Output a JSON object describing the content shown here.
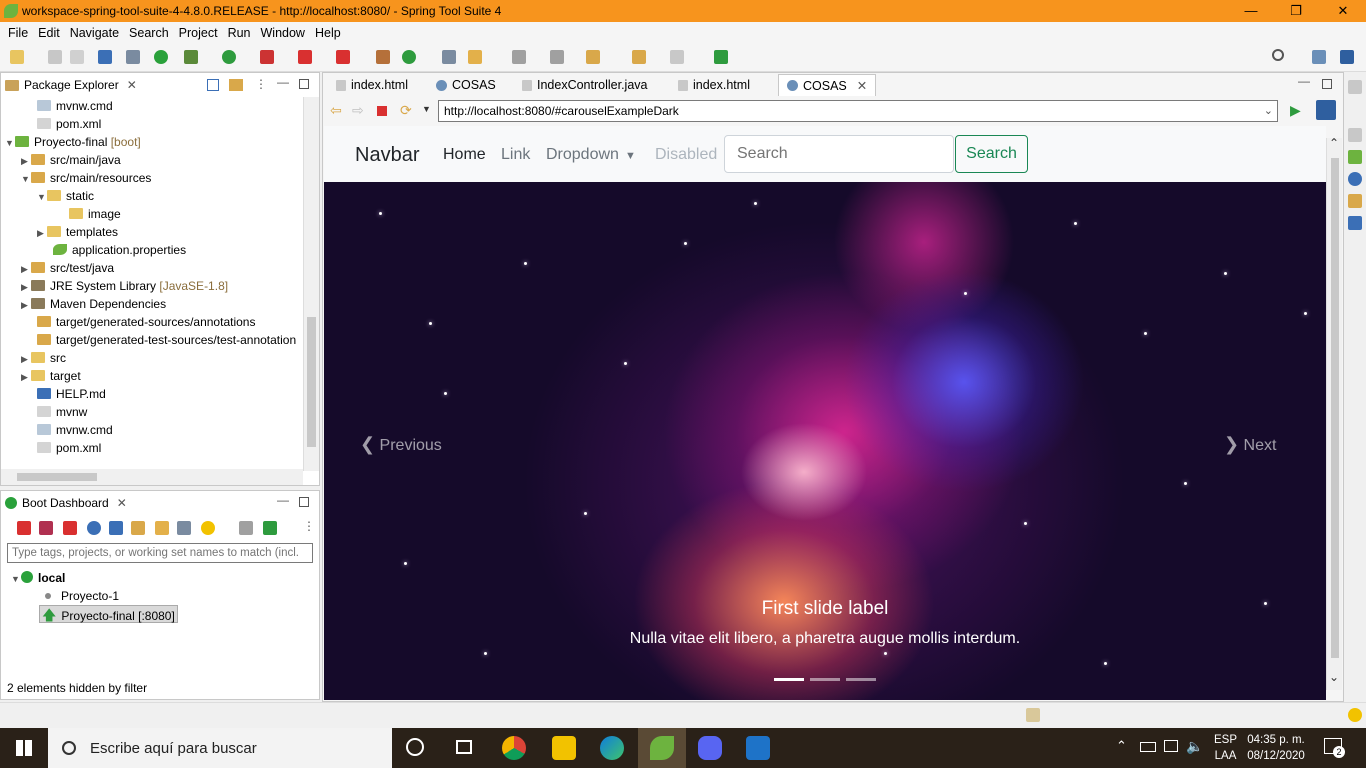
{
  "window": {
    "title": "workspace-spring-tool-suite-4-4.8.0.RELEASE - http://localhost:8080/ - Spring Tool Suite 4"
  },
  "menu": [
    "File",
    "Edit",
    "Navigate",
    "Search",
    "Project",
    "Run",
    "Window",
    "Help"
  ],
  "package_explorer": {
    "title": "Package Explorer",
    "items": [
      {
        "label": "mvnw.cmd",
        "decor": ""
      },
      {
        "label": "pom.xml",
        "decor": ""
      },
      {
        "label": "Proyecto-final",
        "decor": "[boot]"
      },
      {
        "label": "src/main/java",
        "decor": ""
      },
      {
        "label": "src/main/resources",
        "decor": ""
      },
      {
        "label": "static",
        "decor": ""
      },
      {
        "label": "image",
        "decor": ""
      },
      {
        "label": "templates",
        "decor": ""
      },
      {
        "label": "application.properties",
        "decor": ""
      },
      {
        "label": "src/test/java",
        "decor": ""
      },
      {
        "label": "JRE System Library",
        "decor": "[JavaSE-1.8]"
      },
      {
        "label": "Maven Dependencies",
        "decor": ""
      },
      {
        "label": "target/generated-sources/annotations",
        "decor": ""
      },
      {
        "label": "target/generated-test-sources/test-annotation",
        "decor": ""
      },
      {
        "label": "src",
        "decor": ""
      },
      {
        "label": "target",
        "decor": ""
      },
      {
        "label": "HELP.md",
        "decor": ""
      },
      {
        "label": "mvnw",
        "decor": ""
      },
      {
        "label": "mvnw.cmd",
        "decor": ""
      },
      {
        "label": "pom.xml",
        "decor": ""
      }
    ]
  },
  "boot_dashboard": {
    "title": "Boot Dashboard",
    "filter_placeholder": "Type tags, projects, or working set names to match (incl.",
    "group": "local",
    "apps": [
      "Proyecto-1",
      "Proyecto-final [:8080]"
    ],
    "footer": "2 elements hidden by filter"
  },
  "editor_tabs": [
    "index.html",
    "COSAS",
    "IndexController.java",
    "index.html",
    "COSAS"
  ],
  "browser": {
    "url": "http://localhost:8080/#carouselExampleDark",
    "navbar": {
      "brand": "Navbar",
      "links": [
        "Home",
        "Link",
        "Dropdown",
        "Disabled"
      ],
      "search_placeholder": "Search",
      "search_button": "Search"
    },
    "carousel": {
      "caption_title": "First slide label",
      "caption_text": "Nulla vitae elit libero, a pharetra augue mollis interdum.",
      "prev": "Previous",
      "next": "Next",
      "slide_count": 3,
      "active_slide": 1
    }
  },
  "taskbar": {
    "search_placeholder": "Escribe aquí para buscar",
    "lang": "ESP",
    "lang2": "LAA",
    "time": "04:35 p. m.",
    "date": "08/12/2020",
    "notifications": "2"
  },
  "colors": {
    "titlebar": "#f7941d",
    "search_button": "#198754",
    "taskbar": "#2a2118"
  }
}
